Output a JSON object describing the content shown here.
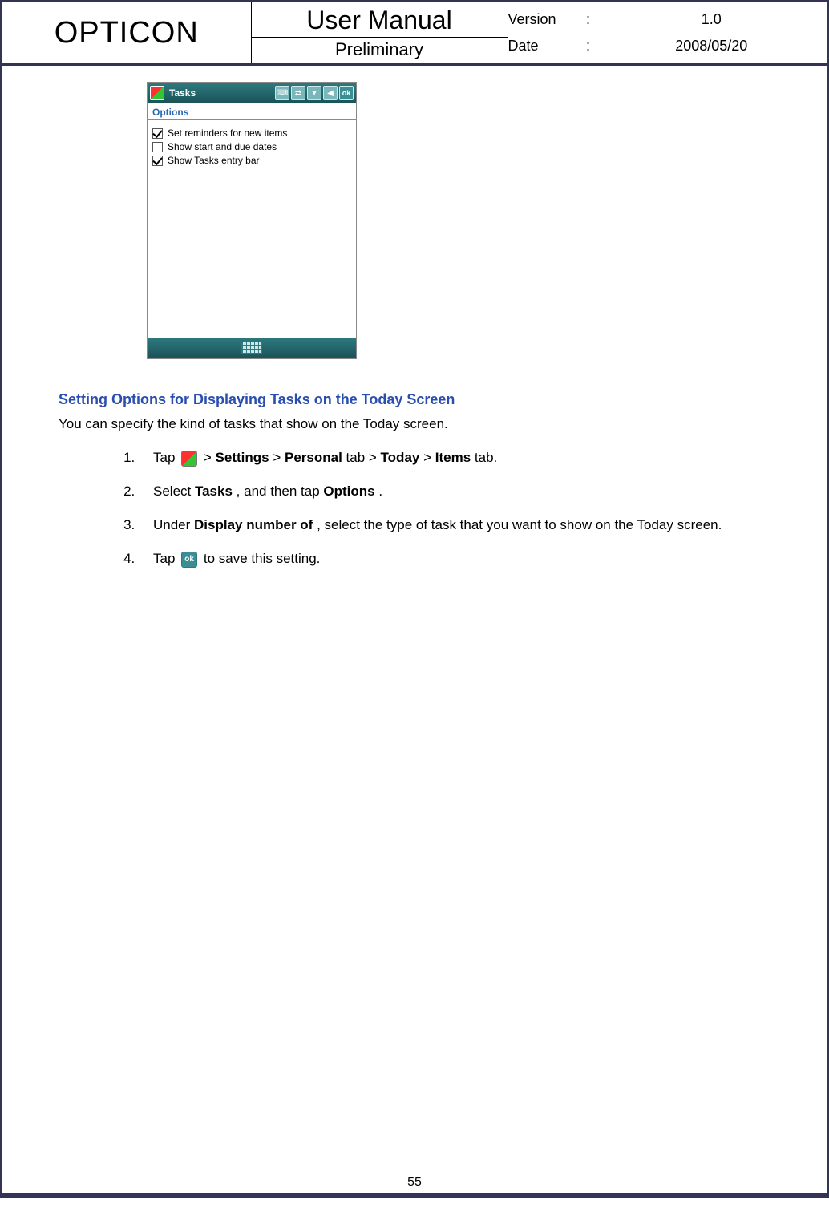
{
  "header": {
    "logo": "OPTICON",
    "title": "User Manual",
    "subtitle": "Preliminary",
    "version_label": "Version",
    "version_value": "1.0",
    "date_label": "Date",
    "date_value": "2008/05/20",
    "colon": ":"
  },
  "phone": {
    "title": "Tasks",
    "ok": "ok",
    "options_tab": "Options",
    "options": [
      {
        "label": "Set reminders for new items",
        "checked": true
      },
      {
        "label": "Show start and due dates",
        "checked": false
      },
      {
        "label": "Show Tasks entry bar",
        "checked": true
      }
    ]
  },
  "section": {
    "heading": "Setting Options for Displaying Tasks on the Today Screen",
    "intro": "You can specify the kind of tasks that show on the Today screen."
  },
  "steps": {
    "s1_a": "Tap ",
    "s1_b": " > ",
    "s1_settings": "Settings",
    "s1_c": " > ",
    "s1_personal": "Personal",
    "s1_d": " tab > ",
    "s1_today": "Today",
    "s1_e": " > ",
    "s1_items": "Items",
    "s1_f": " tab.",
    "s2_a": "Select ",
    "s2_tasks": "Tasks",
    "s2_b": ", and then tap ",
    "s2_options": "Options",
    "s2_c": ".",
    "s3_a": "Under ",
    "s3_display": "Display number of",
    "s3_b": ", select the type of task that you want to show on the Today screen.",
    "s4_a": "Tap ",
    "s4_ok": "ok",
    "s4_b": " to save this setting."
  },
  "page_number": "55"
}
